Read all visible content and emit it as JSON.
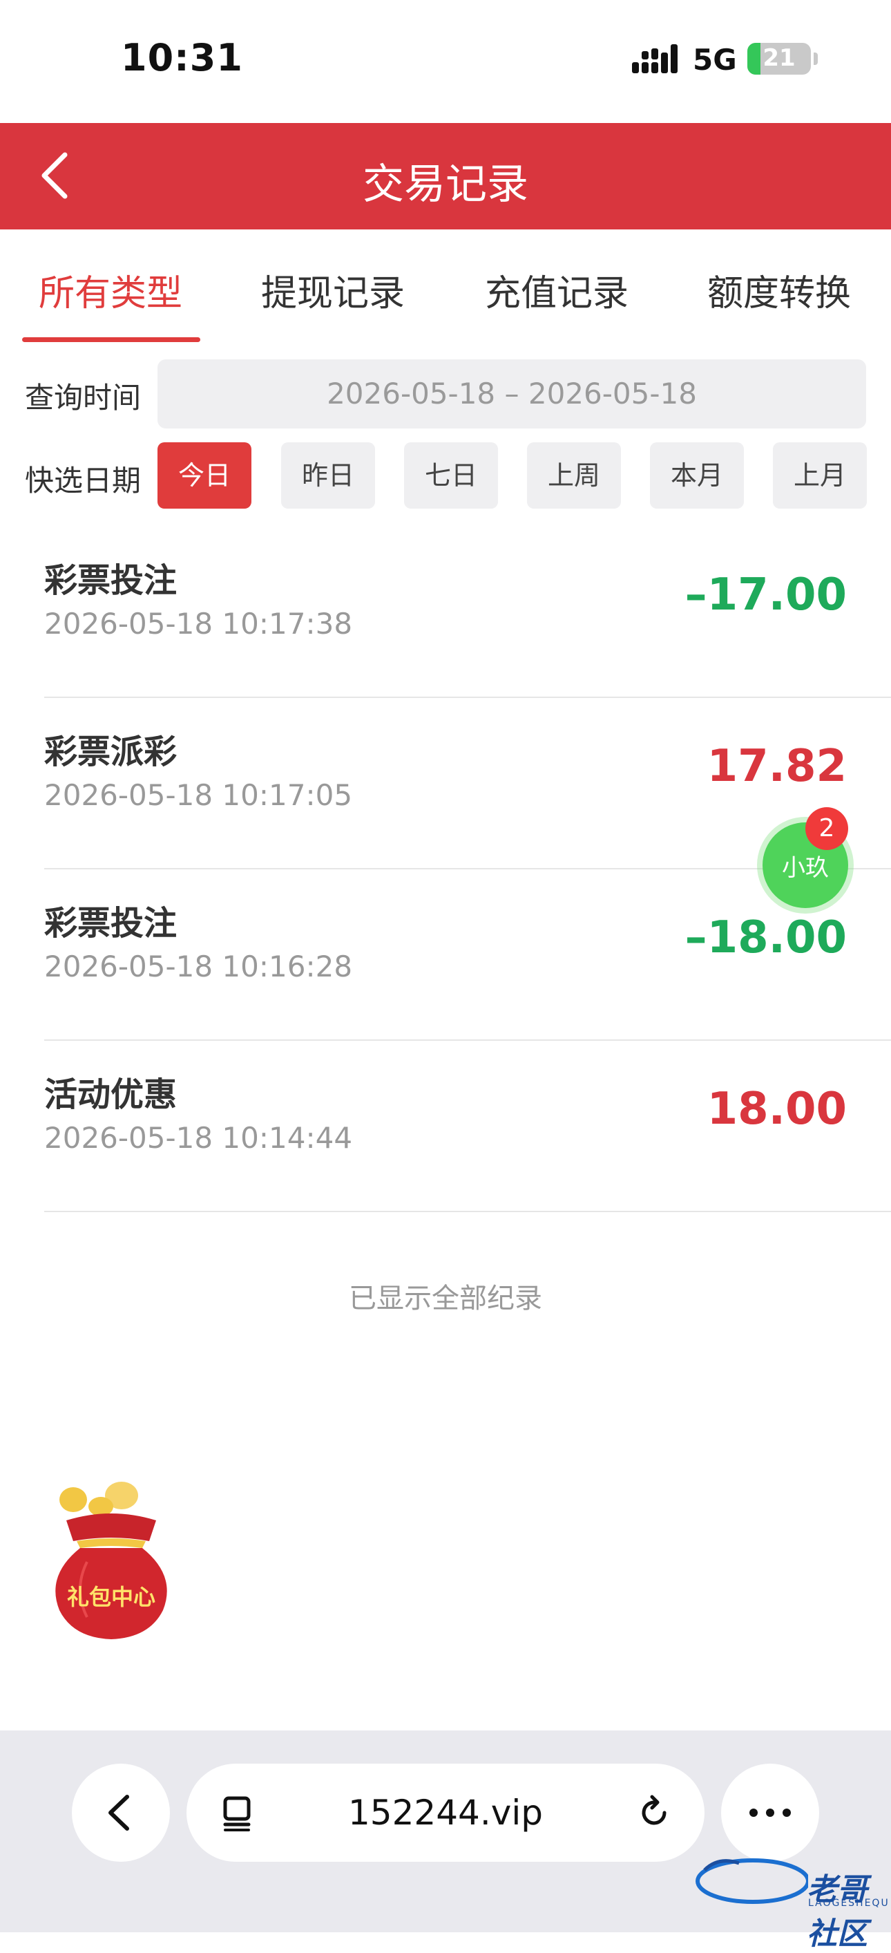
{
  "status_bar": {
    "time": "10:31",
    "network": "5G",
    "battery": "21",
    "battery_level": 0.21,
    "colors": {
      "battery": "#34c759"
    }
  },
  "header": {
    "title": "交易记录",
    "back_icon": "chevron-left-icon",
    "color": "#d9363e"
  },
  "tabs": [
    {
      "label": "所有类型",
      "active": true
    },
    {
      "label": "提现记录",
      "active": false
    },
    {
      "label": "充值记录",
      "active": false
    },
    {
      "label": "额度转换",
      "active": false
    }
  ],
  "filters": {
    "query_time_label": "查询时间",
    "date_range": "2026-05-18 – 2026-05-18",
    "quick_date_label": "快选日期",
    "quick_options": [
      {
        "label": "今日",
        "active": true
      },
      {
        "label": "昨日",
        "active": false
      },
      {
        "label": "七日",
        "active": false
      },
      {
        "label": "上周",
        "active": false
      },
      {
        "label": "本月",
        "active": false
      },
      {
        "label": "上月",
        "active": false
      }
    ]
  },
  "transactions": [
    {
      "title": "彩票投注",
      "time": "2026-05-18 10:17:38",
      "amount": "–17.00",
      "direction": "negative"
    },
    {
      "title": "彩票派彩",
      "time": "2026-05-18 10:17:05",
      "amount": "17.82",
      "direction": "positive"
    },
    {
      "title": "彩票投注",
      "time": "2026-05-18 10:16:28",
      "amount": "–18.00",
      "direction": "negative"
    },
    {
      "title": "活动优惠",
      "time": "2026-05-18 10:14:44",
      "amount": "18.00",
      "direction": "positive"
    }
  ],
  "list_end_text": "已显示全部纪录",
  "chat": {
    "label": "小玖",
    "badge": "2",
    "color": "#4fd35a"
  },
  "gift_center": {
    "label": "礼包中心",
    "icon": "gift-bag-icon"
  },
  "browser": {
    "url": "152244.vip",
    "back_icon": "chevron-left-icon",
    "tabs_icon": "page-menu-icon",
    "reload_icon": "reload-icon",
    "more_icon": "more-icon"
  },
  "watermark": {
    "text": "老哥社区",
    "sub": "LAOGESHEQU"
  },
  "colors": {
    "accent": "#e03c3c",
    "negative": "#1eaa5a",
    "positive": "#d9363e"
  }
}
